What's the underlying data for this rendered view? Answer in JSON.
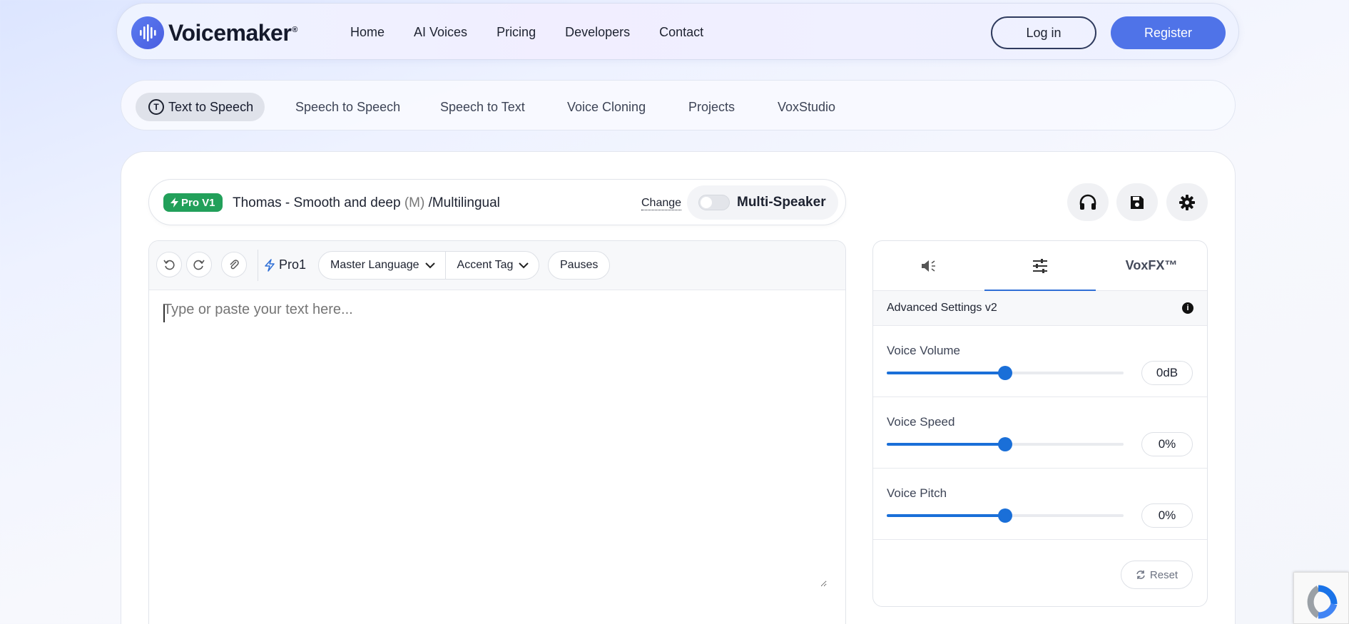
{
  "brand": {
    "name": "Voicemaker",
    "reg": "®"
  },
  "nav": {
    "links": [
      "Home",
      "AI Voices",
      "Pricing",
      "Developers",
      "Contact"
    ],
    "login": "Log in",
    "register": "Register"
  },
  "subtabs": {
    "items": [
      "Text to Speech",
      "Speech to Speech",
      "Speech to Text",
      "Voice Cloning",
      "Projects",
      "VoxStudio"
    ],
    "active": "Text to Speech"
  },
  "voice": {
    "badge": "Pro V1",
    "name": "Thomas - Smooth and deep",
    "gender": "(M)",
    "lang": "/Multilingual",
    "change": "Change",
    "multi_speaker": "Multi-Speaker"
  },
  "toolbar": {
    "engine": "Pro1",
    "master_language": "Master Language",
    "accent_tag": "Accent Tag",
    "pauses": "Pauses"
  },
  "editor": {
    "placeholder": "Type or paste your text here..."
  },
  "panel": {
    "tab_voxfx": "VoxFX™",
    "header": "Advanced Settings v2",
    "sliders": [
      {
        "label": "Voice Volume",
        "value": "0dB",
        "level": 0.5
      },
      {
        "label": "Voice Speed",
        "value": "0%",
        "level": 0.5
      },
      {
        "label": "Voice Pitch",
        "value": "0%",
        "level": 0.5
      }
    ],
    "reset": "Reset"
  },
  "colors": {
    "accent": "#4f73e8",
    "badge_green": "#22a05a",
    "slider_blue": "#1a6fd8"
  }
}
